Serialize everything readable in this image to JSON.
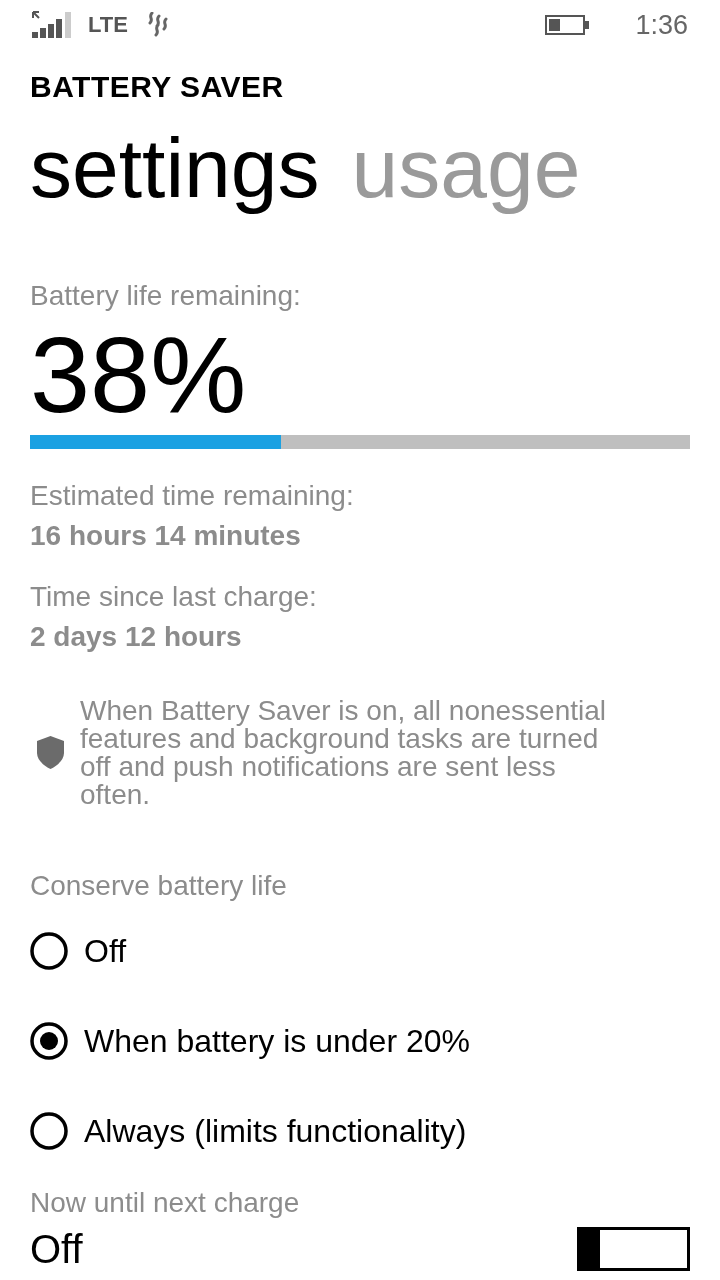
{
  "status_bar": {
    "network": "LTE",
    "time": "1:36"
  },
  "app_title": "BATTERY SAVER",
  "pivots": [
    {
      "label": "settings",
      "selected": true
    },
    {
      "label": "usage",
      "selected": false
    }
  ],
  "battery": {
    "label": "Battery life remaining:",
    "percent": "38%",
    "level": 0.38
  },
  "stats": [
    {
      "label": "Estimated time remaining:",
      "value": "16 hours 14 minutes"
    },
    {
      "label": "Time since last charge:",
      "value": "2 days 12 hours"
    }
  ],
  "notice": "When Battery Saver is on, all nonessential features and background tasks are turned off and push notifications are sent less often.",
  "conserve": {
    "label": "Conserve battery life",
    "options": [
      {
        "label": "Off",
        "selected": false
      },
      {
        "label": "When battery is under 20%",
        "selected": true
      },
      {
        "label": "Always (limits functionality)",
        "selected": false
      }
    ]
  },
  "next_charge": {
    "label": "Now until next charge",
    "value": "Off",
    "on": false
  }
}
